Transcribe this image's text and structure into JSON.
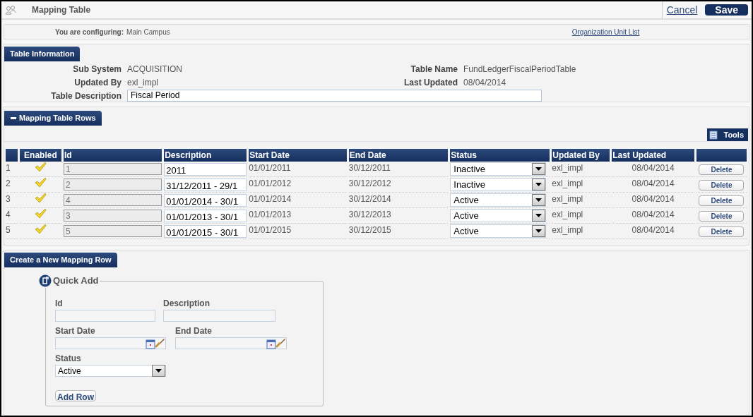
{
  "header": {
    "title": "Mapping Table",
    "cancel": "Cancel",
    "save": "Save"
  },
  "config": {
    "label": "You are configuring:",
    "value": "Main Campus",
    "link": "Organization Unit List"
  },
  "table_information": {
    "title": "Table Information",
    "sub_system_label": "Sub System",
    "sub_system": "ACQUISITION",
    "table_name_label": "Table Name",
    "table_name": "FundLedgerFiscalPeriodTable",
    "updated_by_label": "Updated By",
    "updated_by": "exl_impl",
    "last_updated_label": "Last Updated",
    "last_updated": "08/04/2014",
    "description_label": "Table Description",
    "description": "Fiscal Period"
  },
  "mapping_rows": {
    "title": "Mapping Table Rows",
    "expanded": true,
    "tools": "Tools",
    "columns": [
      "Enabled",
      "Id",
      "Description",
      "Start Date",
      "End Date",
      "Status",
      "Updated By",
      "Last Updated"
    ],
    "rows": [
      {
        "number": "1",
        "enabled": true,
        "id": "1",
        "description": "2011",
        "start_date": "01/01/2011",
        "end_date": "30/12/2011",
        "status": "Inactive",
        "updated_by": "exl_impl",
        "last_updated": "08/04/2014",
        "action": "Delete"
      },
      {
        "number": "2",
        "enabled": true,
        "id": "2",
        "description": "31/12/2011 - 29/1",
        "start_date": "01/01/2012",
        "end_date": "30/12/2012",
        "status": "Inactive",
        "updated_by": "exl_impl",
        "last_updated": "08/04/2014",
        "action": "Delete"
      },
      {
        "number": "3",
        "enabled": true,
        "id": "4",
        "description": "01/01/2014 - 30/1",
        "start_date": "01/01/2014",
        "end_date": "30/12/2014",
        "status": "Active",
        "updated_by": "exl_impl",
        "last_updated": "08/04/2014",
        "action": "Delete"
      },
      {
        "number": "4",
        "enabled": true,
        "id": "3",
        "description": "01/01/2013 - 30/1",
        "start_date": "01/01/2013",
        "end_date": "30/12/2013",
        "status": "Active",
        "updated_by": "exl_impl",
        "last_updated": "08/04/2014",
        "action": "Delete"
      },
      {
        "number": "5",
        "enabled": true,
        "id": "5",
        "description": "01/01/2015 - 30/1",
        "start_date": "01/01/2015",
        "end_date": "30/12/2015",
        "status": "Active",
        "updated_by": "exl_impl",
        "last_updated": "08/04/2014",
        "action": "Delete"
      }
    ]
  },
  "create_row": {
    "title": "Create a New Mapping Row",
    "quick_add": {
      "title": "Quick Add",
      "id_label": "Id",
      "description_label": "Description",
      "start_date_label": "Start Date",
      "end_date_label": "End Date",
      "status_label": "Status",
      "status": "Active",
      "button": "Add Row"
    }
  }
}
